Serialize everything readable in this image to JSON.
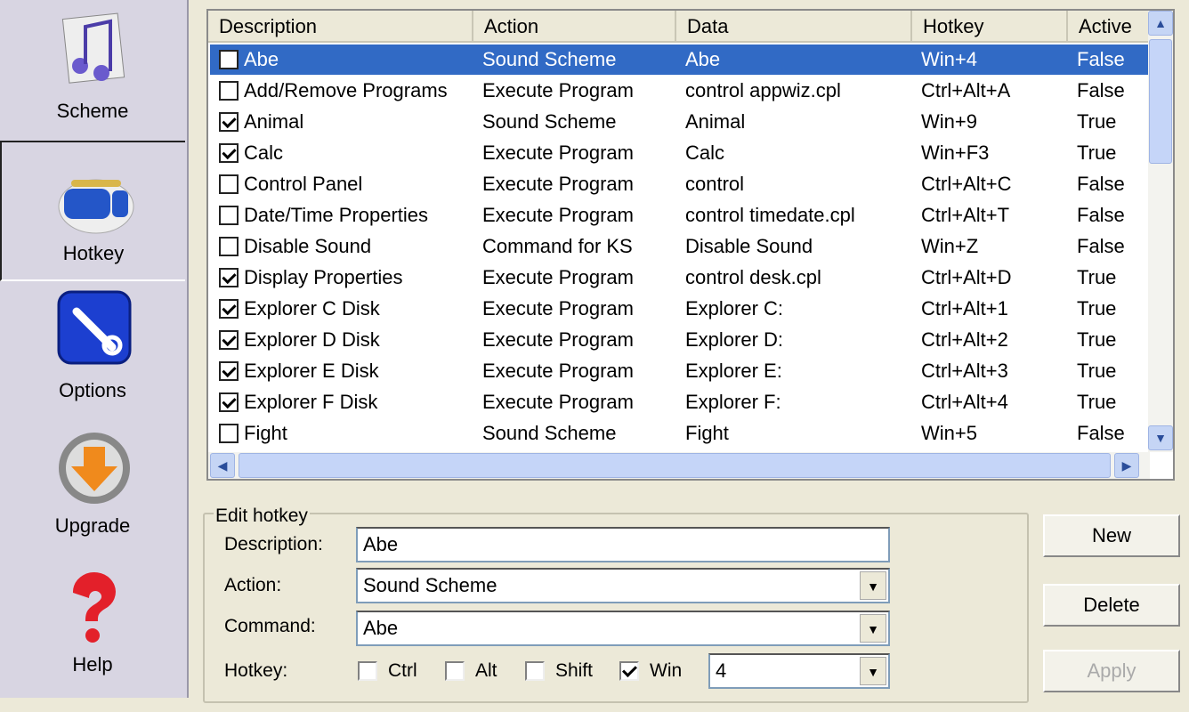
{
  "sidebar": {
    "items": [
      {
        "label": "Scheme",
        "icon": "music-notes-icon"
      },
      {
        "label": "Hotkey",
        "icon": "keyboard-icon",
        "selected": true
      },
      {
        "label": "Options",
        "icon": "wrench-icon"
      },
      {
        "label": "Upgrade",
        "icon": "down-arrow-icon"
      },
      {
        "label": "Help",
        "icon": "question-mark-icon"
      }
    ]
  },
  "table": {
    "columns": [
      "Description",
      "Action",
      "Data",
      "Hotkey",
      "Active"
    ],
    "rows": [
      {
        "checked": false,
        "description": "Abe",
        "action": "Sound Scheme",
        "data": "Abe",
        "hotkey": "Win+4",
        "active": "False",
        "selected": true
      },
      {
        "checked": false,
        "description": "Add/Remove Programs",
        "action": "Execute Program",
        "data": "control appwiz.cpl",
        "hotkey": "Ctrl+Alt+A",
        "active": "False"
      },
      {
        "checked": true,
        "description": "Animal",
        "action": "Sound Scheme",
        "data": "Animal",
        "hotkey": "Win+9",
        "active": "True"
      },
      {
        "checked": true,
        "description": "Calc",
        "action": "Execute Program",
        "data": "Calc",
        "hotkey": "Win+F3",
        "active": "True"
      },
      {
        "checked": false,
        "description": "Control Panel",
        "action": "Execute Program",
        "data": "control",
        "hotkey": "Ctrl+Alt+C",
        "active": "False"
      },
      {
        "checked": false,
        "description": "Date/Time Properties",
        "action": "Execute Program",
        "data": "control timedate.cpl",
        "hotkey": "Ctrl+Alt+T",
        "active": "False"
      },
      {
        "checked": false,
        "description": "Disable Sound",
        "action": "Command for KS",
        "data": "Disable Sound",
        "hotkey": "Win+Z",
        "active": "False"
      },
      {
        "checked": true,
        "description": "Display Properties",
        "action": "Execute Program",
        "data": "control desk.cpl",
        "hotkey": "Ctrl+Alt+D",
        "active": "True"
      },
      {
        "checked": true,
        "description": "Explorer C Disk",
        "action": "Execute Program",
        "data": "Explorer C:",
        "hotkey": "Ctrl+Alt+1",
        "active": "True"
      },
      {
        "checked": true,
        "description": "Explorer D Disk",
        "action": "Execute Program",
        "data": "Explorer D:",
        "hotkey": "Ctrl+Alt+2",
        "active": "True"
      },
      {
        "checked": true,
        "description": "Explorer E Disk",
        "action": "Execute Program",
        "data": "Explorer E:",
        "hotkey": "Ctrl+Alt+3",
        "active": "True"
      },
      {
        "checked": true,
        "description": "Explorer F Disk",
        "action": "Execute Program",
        "data": "Explorer F:",
        "hotkey": "Ctrl+Alt+4",
        "active": "True"
      },
      {
        "checked": false,
        "description": "Fight",
        "action": "Sound Scheme",
        "data": "Fight",
        "hotkey": "Win+5",
        "active": "False"
      }
    ]
  },
  "edit": {
    "title": "Edit hotkey",
    "description_label": "Description:",
    "description_value": "Abe",
    "action_label": "Action:",
    "action_value": "Sound Scheme",
    "command_label": "Command:",
    "command_value": "Abe",
    "hotkey_label": "Hotkey:",
    "modifiers": [
      {
        "label": "Ctrl",
        "checked": false
      },
      {
        "label": "Alt",
        "checked": false
      },
      {
        "label": "Shift",
        "checked": false
      },
      {
        "label": "Win",
        "checked": true
      }
    ],
    "key_value": "4"
  },
  "buttons": {
    "new": "New",
    "delete": "Delete",
    "apply": "Apply",
    "apply_enabled": false
  },
  "colors": {
    "selection": "#316ac5",
    "sidebar": "#d8d5e2"
  }
}
